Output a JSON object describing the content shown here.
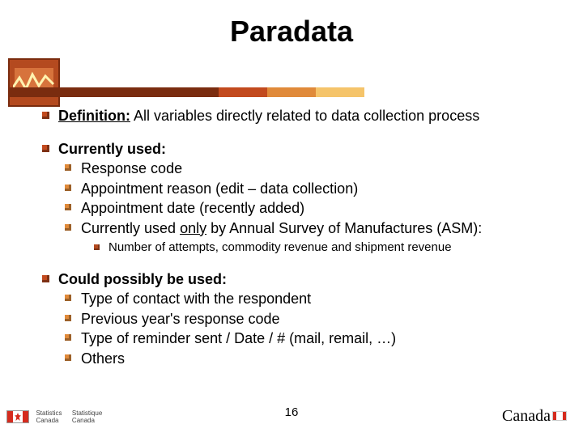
{
  "title": "Paradata",
  "stripe_colors": [
    "#7a2c0f",
    "#c24a1e",
    "#e08a3a",
    "#f5c46a"
  ],
  "bullets": {
    "def_label": "Definition:",
    "def_text": " All variables directly related to data collection process",
    "used_label": "Currently used:",
    "used_items": [
      "Response code",
      "Appointment reason (edit – data collection)",
      "Appointment date (recently added)"
    ],
    "used_only_pre": "Currently used ",
    "used_only_word": "only",
    "used_only_post": " by Annual Survey of Manufactures (ASM):",
    "used_sub": "Number of attempts, commodity revenue and shipment revenue",
    "possible_label": "Could possibly be used:",
    "possible_items": [
      "Type of contact with the respondent",
      "Previous year's response code",
      "Type of reminder sent / Date / # (mail, remail, …)",
      "Others"
    ]
  },
  "footer": {
    "left1": "Statistics",
    "left2": "Canada",
    "right1": "Statistique",
    "right2": "Canada",
    "slidenum": "16",
    "wordmark": "Canada"
  }
}
